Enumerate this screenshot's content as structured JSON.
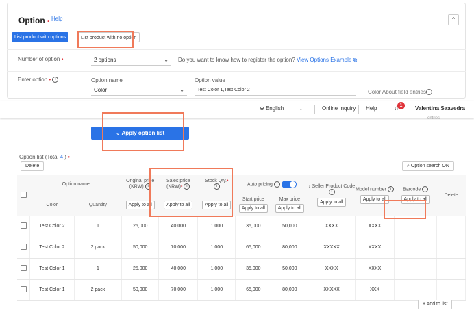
{
  "option": {
    "title": "Option",
    "required_mark": "•",
    "help": "Help",
    "collapse_icon": "^",
    "tabs": [
      "List product with options",
      "List product with no option"
    ],
    "number_label": "Number of option",
    "number_value": "2 options",
    "register_text": "Do you want to know how to register the option?",
    "register_link": "View Options Example",
    "enter_label": "Enter option",
    "option_name_label": "Option name",
    "option_name_value": "Color",
    "option_value_label": "Option value",
    "option_value_value": "Test Color 1,Test Color 2",
    "color_about": "Color About field entries",
    "entries_clipped": "entries",
    "apply_button": "Apply option list"
  },
  "header": {
    "language": "English",
    "online_inquiry": "Online Inquiry",
    "help": "Help",
    "bell_count": "1",
    "user": "Valentina Saavedra"
  },
  "list": {
    "title_prefix": "Option list (Total",
    "total": "4",
    "title_suffix": ")",
    "required_mark": "•",
    "delete": "Delete",
    "search_on": "Option search ON",
    "add_to_list": "+ Add to list",
    "headers": {
      "option_name": "Option name",
      "color": "Color",
      "quantity": "Quantity",
      "original_price": "Original price (KRW)",
      "sales_price": "Sales price (KRW)",
      "stock_qty": "Stock Qty.",
      "auto_pricing": "Auto pricing",
      "start_price": "Start price",
      "max_price": "Max price",
      "seller_code": "↓ Seller Product Code",
      "model_number": "Model number",
      "barcode": "Barcode",
      "delete": "Delete"
    },
    "apply_all": "Apply to all",
    "rows": [
      {
        "color": "Test Color 2",
        "quantity": "1",
        "original": "25,000",
        "sales": "40,000",
        "stock": "1,000",
        "start": "35,000",
        "max": "50,000",
        "code": "XXXX",
        "model": "XXXX"
      },
      {
        "color": "Test Color 2",
        "quantity": "2 pack",
        "original": "50,000",
        "sales": "70,000",
        "stock": "1,000",
        "start": "65,000",
        "max": "80,000",
        "code": "XXXXX",
        "model": "XXXX"
      },
      {
        "color": "Test Color 1",
        "quantity": "1",
        "original": "25,000",
        "sales": "40,000",
        "stock": "1,000",
        "start": "35,000",
        "max": "50,000",
        "code": "XXXX",
        "model": "XXXX"
      },
      {
        "color": "Test Color 1",
        "quantity": "2 pack",
        "original": "50,000",
        "sales": "70,000",
        "stock": "1,000",
        "start": "65,000",
        "max": "80,000",
        "code": "XXXXX",
        "model": "XXX"
      }
    ]
  },
  "colors": {
    "accent": "#2a73e6",
    "required": "#e0333a",
    "highlight": "#f07a5a"
  }
}
